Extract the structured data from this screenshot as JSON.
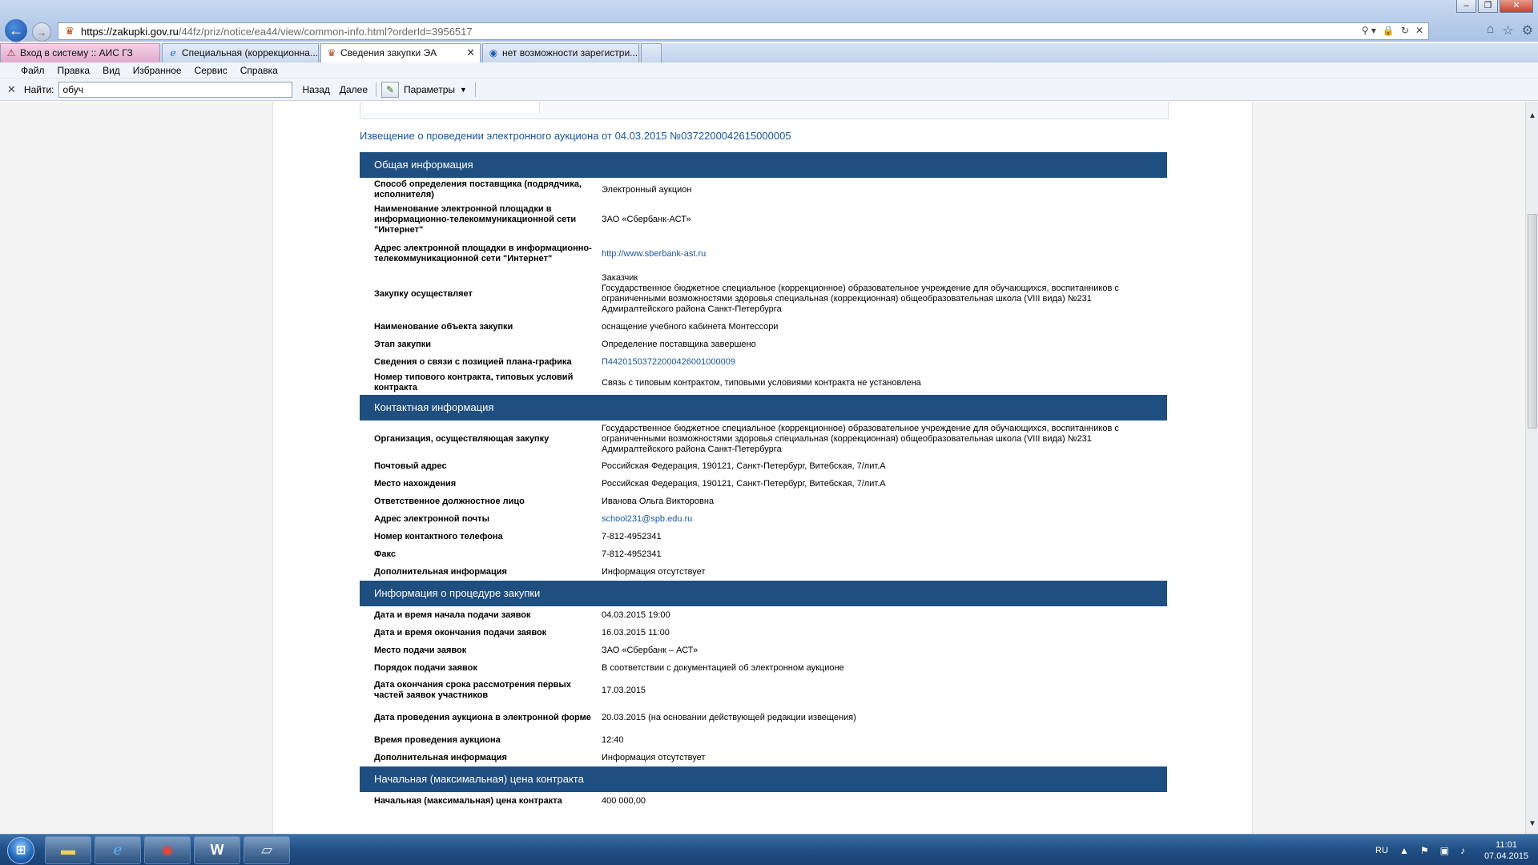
{
  "browser": {
    "url_host": "https://zakupki.gov.ru",
    "url_path": "/44fz/priz/notice/ea44/view/common-info.html?orderId=3956517",
    "tabs": [
      {
        "label": "Вход в систему :: АИС ГЗ",
        "style": "pink",
        "icon": "warning-icon"
      },
      {
        "label": "Специальная (коррекционна...",
        "style": "normal",
        "icon": "ie-icon"
      },
      {
        "label": "Сведения закупки ЭА",
        "style": "active",
        "icon": "emblem-icon"
      },
      {
        "label": "нет возможности зарегистри...",
        "style": "normal",
        "icon": "globe-icon"
      }
    ],
    "menu": [
      "Файл",
      "Правка",
      "Вид",
      "Избранное",
      "Сервис",
      "Справка"
    ],
    "find": {
      "label": "Найти:",
      "value": "обуч",
      "back": "Назад",
      "next": "Далее",
      "params": "Параметры"
    }
  },
  "page": {
    "notice_title": "Извещение о проведении электронного аукциона от 04.03.2015 №0372200042615000005",
    "sections": [
      {
        "header": "Общая информация",
        "rows": [
          {
            "label": "Способ определения поставщика (подрядчика, исполнителя)",
            "value": "Электронный аукцион"
          },
          {
            "label": "Наименование электронной площадки в информационно-телекоммуникационной сети \"Интернет\"",
            "value": "ЗАО «Сбербанк-АСТ»"
          },
          {
            "label": "Адрес электронной площадки в информационно-телекоммуникационной сети \"Интернет\"",
            "value": "http://www.sberbank-ast.ru",
            "link": true
          },
          {
            "label": "Закупку осуществляет",
            "value": "Заказчик\nГосударственное бюджетное специальное (коррекционное) образовательное учреждение для обучающихся, воспитанников с ограниченными возможностями здоровья специальная (коррекционная) общеобразовательная школа (VIII вида) №231 Адмиралтейского района Санкт-Петербурга"
          },
          {
            "label": "Наименование объекта закупки",
            "value": "оснащение учебного кабинета Монтессори"
          },
          {
            "label": "Этап закупки",
            "value": "Определение поставщика завершено"
          },
          {
            "label": "Сведения о связи с позицией плана-графика",
            "value": "П44201503722000426001000009",
            "link": true
          },
          {
            "label": "Номер типового контракта, типовых условий контракта",
            "value": "Связь с типовым контрактом, типовыми условиями контракта не установлена"
          }
        ]
      },
      {
        "header": "Контактная информация",
        "rows": [
          {
            "label": "Организация, осуществляющая закупку",
            "value": "Государственное бюджетное специальное (коррекционное) образовательное учреждение для обучающихся, воспитанников с ограниченными возможностями здоровья специальная (коррекционная) общеобразовательная школа (VIII вида) №231 Адмиралтейского района Санкт-Петербурга"
          },
          {
            "label": "Почтовый адрес",
            "value": "Российская Федерация, 190121, Санкт-Петербург, Витебская, 7/лит.А"
          },
          {
            "label": "Место нахождения",
            "value": "Российская Федерация, 190121, Санкт-Петербург, Витебская, 7/лит.А"
          },
          {
            "label": "Ответственное должностное лицо",
            "value": "Иванова Ольга Викторовна"
          },
          {
            "label": "Адрес электронной почты",
            "value": "school231@spb.edu.ru",
            "link": true
          },
          {
            "label": "Номер контактного телефона",
            "value": "7-812-4952341"
          },
          {
            "label": "Факс",
            "value": "7-812-4952341"
          },
          {
            "label": "Дополнительная информация",
            "value": "Информация отсутствует"
          }
        ]
      },
      {
        "header": "Информация о процедуре закупки",
        "rows": [
          {
            "label": "Дата и время начала подачи заявок",
            "value": "04.03.2015 19:00"
          },
          {
            "label": "Дата и время окончания подачи заявок",
            "value": "16.03.2015 11:00"
          },
          {
            "label": "Место подачи заявок",
            "value": "ЗАО «Сбербанк – АСТ»"
          },
          {
            "label": "Порядок подачи заявок",
            "value": "В соответствии с документацией об электронном аукционе"
          },
          {
            "label": "Дата окончания срока рассмотрения первых частей заявок участников",
            "value": "17.03.2015"
          },
          {
            "label": "Дата проведения аукциона в электронной форме",
            "value": "20.03.2015 (на основании действующей редакции извещения)"
          },
          {
            "label": "Время проведения аукциона",
            "value": "12:40"
          },
          {
            "label": "Дополнительная информация",
            "value": "Информация отсутствует"
          }
        ]
      },
      {
        "header": "Начальная (максимальная) цена контракта",
        "rows": [
          {
            "label": "Начальная (максимальная) цена контракта",
            "value": "400 000,00"
          }
        ]
      }
    ]
  },
  "taskbar": {
    "apps": [
      {
        "name": "explorer-taskbar-button",
        "icon": "folder-icon"
      },
      {
        "name": "ie-taskbar-button",
        "icon": "ie-icon"
      },
      {
        "name": "chrome-taskbar-button",
        "icon": "chrome-icon"
      },
      {
        "name": "word-taskbar-button",
        "icon": "word-icon"
      },
      {
        "name": "scanner-taskbar-button",
        "icon": "scanner-icon"
      }
    ],
    "lang": "RU",
    "time": "11:01",
    "date": "07.04.2015"
  }
}
